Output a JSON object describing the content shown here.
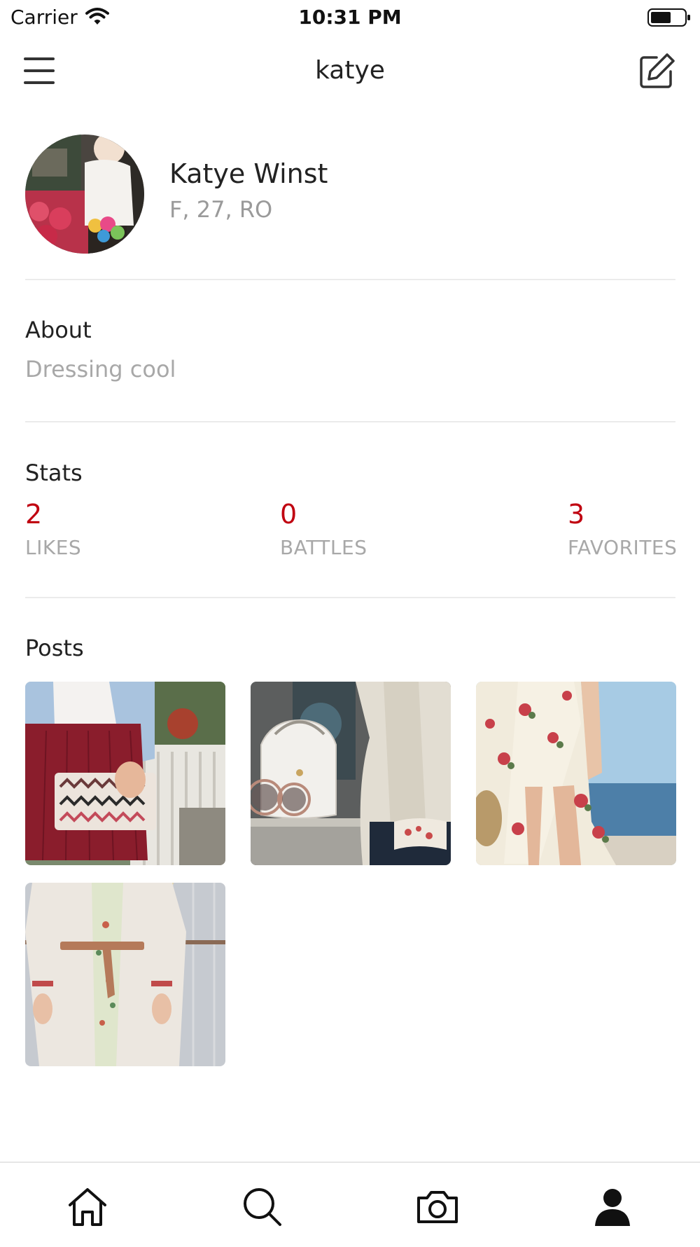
{
  "status_bar": {
    "carrier": "Carrier",
    "time": "10:31 PM",
    "icons": [
      "wifi-icon",
      "battery-icon"
    ]
  },
  "nav": {
    "title": "katye",
    "left_icon": "menu-icon",
    "right_icon": "edit-icon"
  },
  "profile": {
    "name": "Katye Winst",
    "meta": "F, 27, RO"
  },
  "about": {
    "heading": "About",
    "text": "Dressing cool"
  },
  "stats": {
    "heading": "Stats",
    "items": [
      {
        "value": "2",
        "label": "LIKES"
      },
      {
        "value": "0",
        "label": "BATTLES"
      },
      {
        "value": "3",
        "label": "FAVORITES"
      }
    ]
  },
  "posts": {
    "heading": "Posts",
    "items": [
      {
        "name": "post-red-skirt-clutch"
      },
      {
        "name": "post-white-bag-sunglasses"
      },
      {
        "name": "post-floral-dress"
      },
      {
        "name": "post-cream-coat-belt"
      }
    ]
  },
  "tab_bar": {
    "items": [
      {
        "icon": "home-icon"
      },
      {
        "icon": "search-icon"
      },
      {
        "icon": "camera-icon"
      },
      {
        "icon": "profile-icon",
        "active": true
      }
    ]
  },
  "colors": {
    "accent": "#c00010",
    "muted_text": "#a8a8a8",
    "divider": "#ebebeb"
  }
}
